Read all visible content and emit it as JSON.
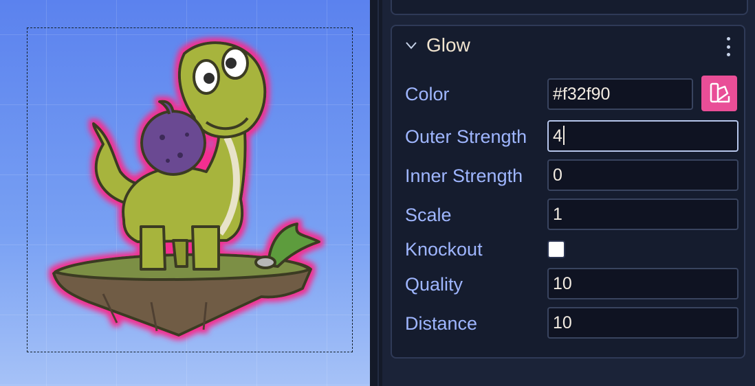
{
  "inspector": {
    "section_title": "Glow",
    "fields": {
      "color": {
        "label": "Color",
        "value": "#f32f90"
      },
      "outer_strength": {
        "label": "Outer Strength",
        "value": "4"
      },
      "inner_strength": {
        "label": "Inner Strength",
        "value": "0"
      },
      "scale": {
        "label": "Scale",
        "value": "1"
      },
      "knockout": {
        "label": "Knockout",
        "checked": false
      },
      "quality": {
        "label": "Quality",
        "value": "10"
      },
      "distance": {
        "label": "Distance",
        "value": "10"
      }
    }
  },
  "icons": {
    "collapse": "chevron-down-icon",
    "menu": "kebab-menu-icon",
    "color_picker": "color-picker-icon"
  },
  "colors": {
    "glow": "#f32f90",
    "panel_bg": "#151c2e",
    "label": "#9fb6ff",
    "title": "#f1e4cf",
    "canvas_top": "#5b82ee",
    "canvas_bottom": "#a6c2f7"
  }
}
